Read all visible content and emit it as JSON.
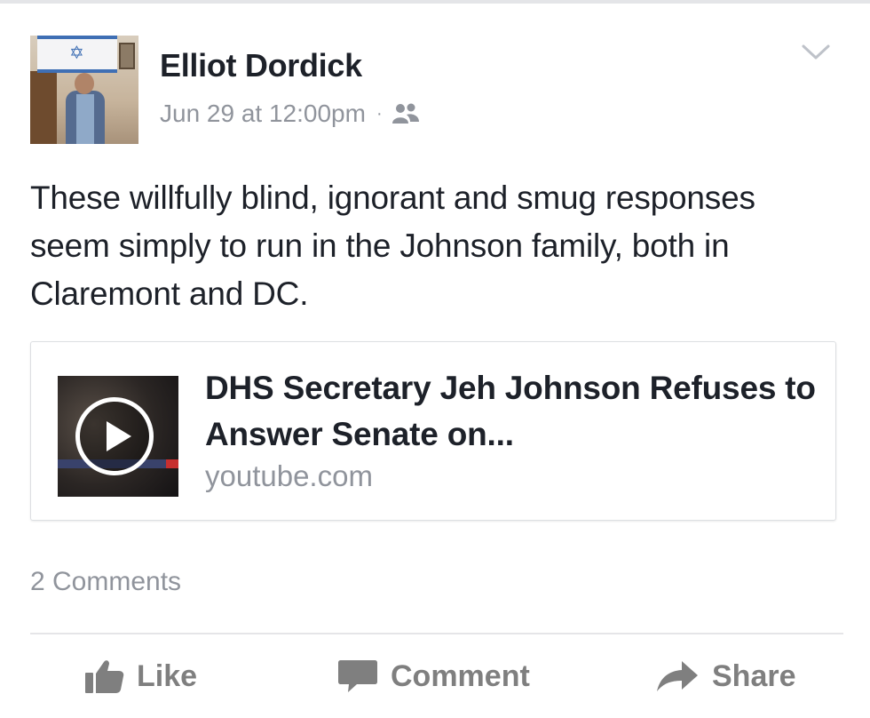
{
  "post": {
    "author": "Elliot Dordick",
    "timestamp": "Jun 29 at 12:00pm",
    "separator": "·",
    "audience_icon": "friends-icon",
    "text": "These willfully blind, ignorant and smug responses seem simply to run in the Johnson family, both in Claremont and DC.",
    "menu_icon": "chevron-down-icon"
  },
  "link": {
    "title": "DHS Secretary Jeh Johnson Refuses to Answer Senate on...",
    "domain": "youtube.com",
    "thumbnail_icon": "play-icon"
  },
  "footer": {
    "comments_count": "2 Comments"
  },
  "actions": {
    "like_label": "Like",
    "comment_label": "Comment",
    "share_label": "Share"
  },
  "colors": {
    "primary_text": "#1d2129",
    "secondary_text": "#90949c",
    "action_text": "#7f7f7f",
    "divider": "#e5e5e8"
  }
}
